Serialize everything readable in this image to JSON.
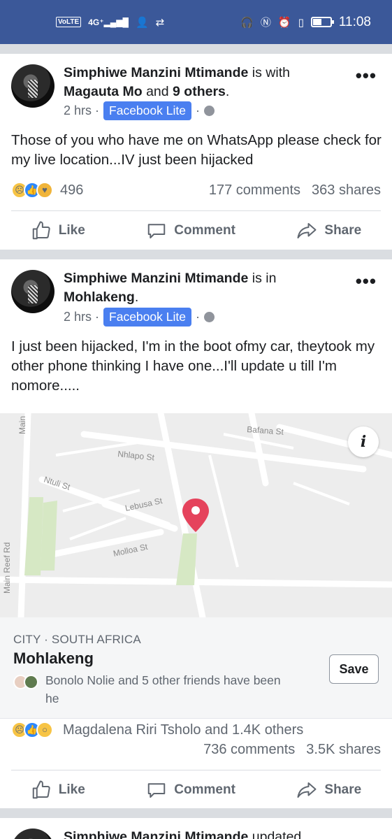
{
  "status_bar": {
    "network": "VoLTE",
    "signal": "4G⁺",
    "time": "11:08",
    "battery_fraction": 0.45
  },
  "posts": [
    {
      "author": "Simphiwe Manzini Mtimande",
      "connector": " is with ",
      "tagged": "Magauta Mo",
      "and_text": " and ",
      "others": "9 others",
      "tail": ".",
      "time": "2 hrs ·",
      "app_badge": "Facebook Lite",
      "dot": "·",
      "text": "Those of you who have me on WhatsApp please check for my live location...IV just been hijacked",
      "reactions_count": "496",
      "comments": "177 comments",
      "shares": "363 shares",
      "actions": {
        "like": "Like",
        "comment": "Comment",
        "share": "Share"
      }
    },
    {
      "author": "Simphiwe Manzini Mtimande",
      "connector": " is in ",
      "location": "Mohlakeng",
      "tail": ".",
      "time": "2 hrs ·",
      "app_badge": "Facebook Lite",
      "dot": "·",
      "text": "I just been hijacked, I'm in the boot ofmy car, theytook my other phone thinking I have one...I'll update u till I'm nomore.....",
      "map": {
        "streets": [
          "Bafana St",
          "Nhlapo St",
          "Ntuli St",
          "Lebusa St",
          "Molloa St",
          "Main",
          "Main Reef Rd"
        ],
        "info_glyph": "i"
      },
      "place": {
        "category": "CITY · SOUTH AFRICA",
        "name": "Mohlakeng",
        "save_label": "Save",
        "friends_text": "Bonolo Nolie and 5 other friends have been he"
      },
      "reactions_text": "Magdalena Riri Tsholo and 1.4K others",
      "comments": "736 comments",
      "shares": "3.5K shares",
      "actions": {
        "like": "Like",
        "comment": "Comment",
        "share": "Share"
      }
    },
    {
      "author_prefix": "Simphiwe Manzini Mtimande",
      "connector": " updated"
    }
  ]
}
